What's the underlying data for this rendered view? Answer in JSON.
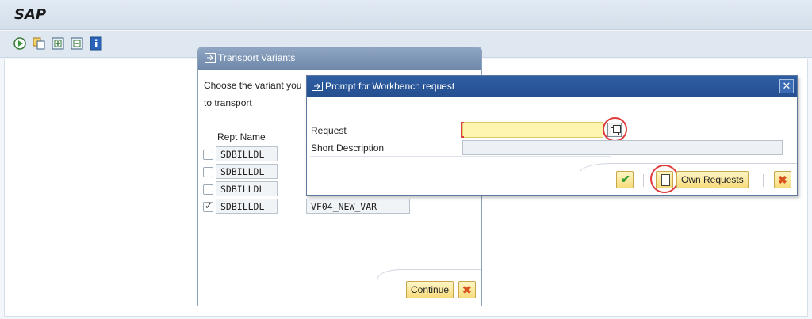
{
  "app": {
    "logo": "SAP"
  },
  "toolbar": {
    "icons": [
      "execute-icon",
      "copy-icon",
      "expand-icon",
      "collapse-icon",
      "info-icon"
    ]
  },
  "transport_dialog": {
    "title": "Transport Variants",
    "prompt_line1": "Choose the variant you",
    "prompt_line2": "to transport",
    "column_header": "Rept Name",
    "rows": [
      {
        "report": "SDBILLDL",
        "variant": "",
        "checked": false
      },
      {
        "report": "SDBILLDL",
        "variant": "",
        "checked": false
      },
      {
        "report": "SDBILLDL",
        "variant": "",
        "checked": false
      },
      {
        "report": "SDBILLDL",
        "variant": "VF04_NEW_VAR",
        "checked": true
      }
    ],
    "continue_label": "Continue"
  },
  "workbench_dialog": {
    "title": "Prompt for Workbench request",
    "request_label": "Request",
    "request_value": "",
    "short_desc_label": "Short Description",
    "short_desc_value": "",
    "own_requests_label": "Own Requests"
  },
  "colors": {
    "dialog_header_active": "#2f5ea3",
    "dialog_header_inactive": "#7d94b5",
    "button_yellow": "#f7dc7d",
    "highlight_ring": "#e03a3a"
  }
}
